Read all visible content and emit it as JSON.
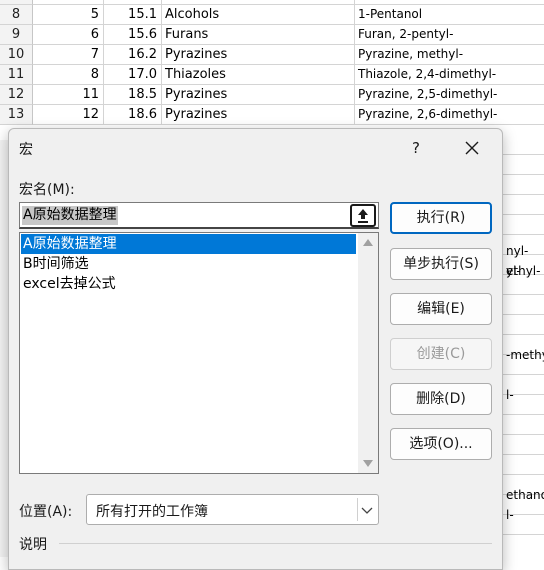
{
  "spreadsheet": {
    "rows": [
      {
        "row": "8",
        "c1": "5",
        "c2": "15.1",
        "c3": "Alcohols",
        "c4": "1-Pentanol"
      },
      {
        "row": "9",
        "c1": "6",
        "c2": "15.6",
        "c3": "Furans",
        "c4": "Furan, 2-pentyl-"
      },
      {
        "row": "10",
        "c1": "7",
        "c2": "16.2",
        "c3": "Pyrazines",
        "c4": "Pyrazine, methyl-"
      },
      {
        "row": "11",
        "c1": "8",
        "c2": "17.0",
        "c3": "Thiazoles",
        "c4": "Thiazole, 2,4-dimethyl-"
      },
      {
        "row": "12",
        "c1": "11",
        "c2": "18.5",
        "c3": "Pyrazines",
        "c4": "Pyrazine, 2,5-dimethyl-"
      },
      {
        "row": "13",
        "c1": "12",
        "c2": "18.6",
        "c3": "Pyrazines",
        "c4": "Pyrazine, 2,6-dimethyl-"
      }
    ],
    "peek": [
      "nyl-",
      "ethyl-",
      "yl-",
      "-methyl-",
      "l-",
      "ethanon",
      "l-"
    ]
  },
  "dialog": {
    "title": "宏",
    "help": "?",
    "name_label": "宏名(M):",
    "name_value": "A原始数据整理",
    "macros": [
      "A原始数据整理",
      "B时间筛选",
      "excel去掉公式"
    ],
    "selected_index": 0,
    "buttons": {
      "run": "执行(R)",
      "step_into": "单步执行(S)",
      "edit": "编辑(E)",
      "create": "创建(C)",
      "delete": "删除(D)",
      "options": "选项(O)..."
    },
    "location_label": "位置(A):",
    "location_value": "所有打开的工作簿",
    "description_label": "说明"
  },
  "icons": {
    "ref": "arrow-up-bar-icon",
    "close": "close-icon",
    "chevron": "chevron-down-icon"
  },
  "colors": {
    "selection": "#0078d7",
    "default_border": "#0067c0"
  }
}
